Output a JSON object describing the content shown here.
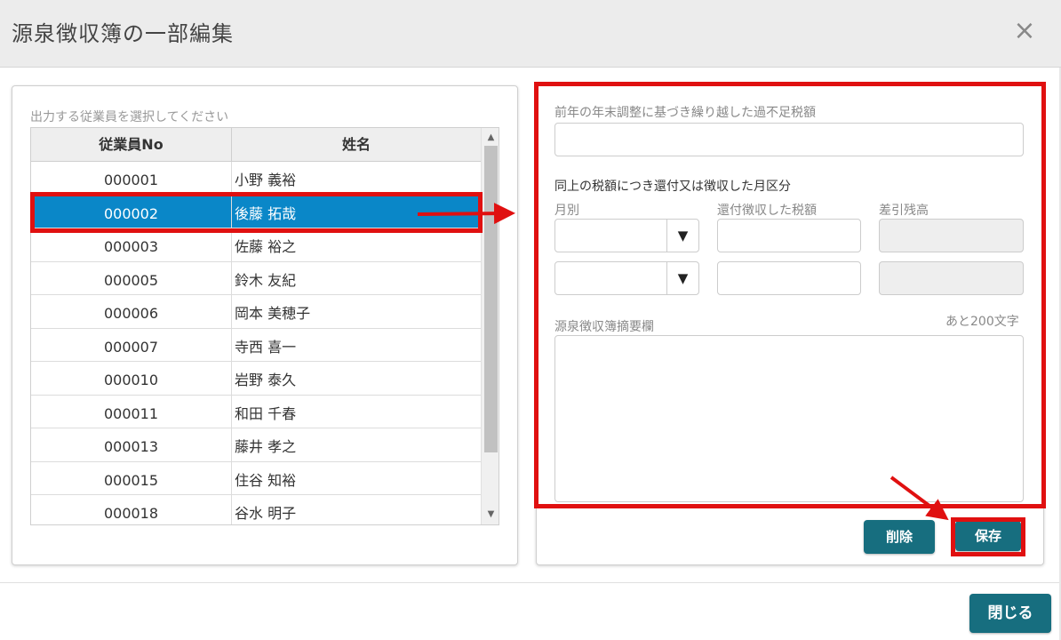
{
  "dialog": {
    "title": "源泉徴収簿の一部編集",
    "close_icon": "×"
  },
  "employee_list": {
    "label": "出力する従業員を選択してください",
    "columns": [
      "従業員No",
      "姓名"
    ],
    "rows": [
      {
        "no": "000001",
        "name": "小野 義裕"
      },
      {
        "no": "000002",
        "name": "後藤 拓哉",
        "selected": true
      },
      {
        "no": "000003",
        "name": "佐藤 裕之"
      },
      {
        "no": "000005",
        "name": "鈴木 友紀"
      },
      {
        "no": "000006",
        "name": "岡本 美穂子"
      },
      {
        "no": "000007",
        "name": "寺西 喜一"
      },
      {
        "no": "000010",
        "name": "岩野 泰久"
      },
      {
        "no": "000011",
        "name": "和田 千春"
      },
      {
        "no": "000013",
        "name": "藤井 孝之"
      },
      {
        "no": "000015",
        "name": "住谷 知裕"
      },
      {
        "no": "000018",
        "name": "谷水 明子"
      }
    ],
    "scroll_up": "▲",
    "scroll_down": "▼"
  },
  "form": {
    "prev_year_label": "前年の年末調整に基づき繰り越した過不足税額",
    "refund_section_label": "同上の税額につき還付又は徴収した月区分",
    "month_label": "月別",
    "tax_label": "還付徴収した税額",
    "balance_label": "差引残高",
    "select_arrow": "▼",
    "remarks_label": "源泉徴収簿摘要欄",
    "remaining_chars": "あと200文字",
    "delete_button": "削除",
    "save_button": "保存"
  },
  "footer": {
    "close_button": "閉じる"
  },
  "colors": {
    "accent": "#176e7f",
    "selection": "#0a87c8",
    "annotation": "#e01010"
  }
}
